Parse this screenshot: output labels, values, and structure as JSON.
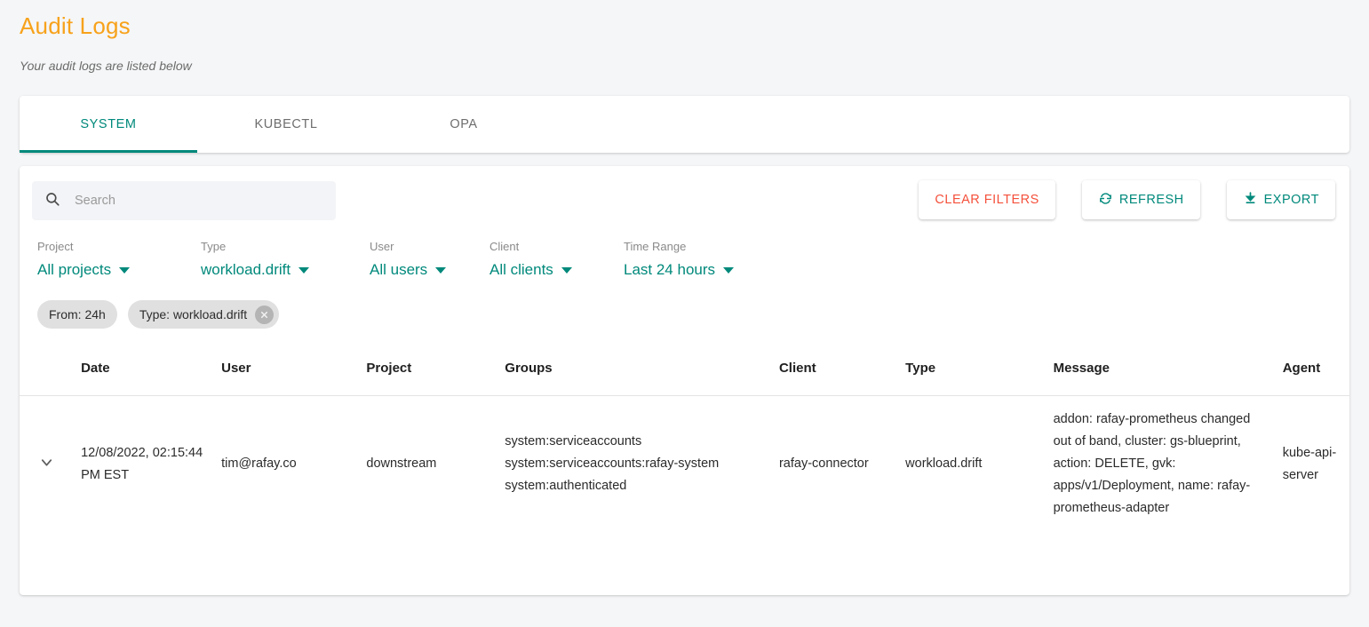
{
  "header": {
    "title": "Audit Logs",
    "subtitle": "Your audit logs are listed below"
  },
  "tabs": [
    {
      "label": "SYSTEM",
      "active": true
    },
    {
      "label": "KUBECTL",
      "active": false
    },
    {
      "label": "OPA",
      "active": false
    }
  ],
  "search": {
    "placeholder": "Search",
    "value": "",
    "icon": "search-icon"
  },
  "actions": {
    "clear_filters": "CLEAR FILTERS",
    "refresh": "REFRESH",
    "export": "EXPORT",
    "refresh_icon": "refresh-icon",
    "export_icon": "download-icon"
  },
  "filters": [
    {
      "label": "Project",
      "value": "All projects"
    },
    {
      "label": "Type",
      "value": "workload.drift"
    },
    {
      "label": "User",
      "value": "All users"
    },
    {
      "label": "Client",
      "value": "All clients"
    },
    {
      "label": "Time Range",
      "value": "Last 24 hours"
    }
  ],
  "chips": [
    {
      "label": "From: 24h",
      "deletable": false
    },
    {
      "label": "Type: workload.drift",
      "deletable": true
    }
  ],
  "table": {
    "columns": [
      "",
      "Date",
      "User",
      "Project",
      "Groups",
      "Client",
      "Type",
      "Message",
      "Agent"
    ],
    "rows": [
      {
        "date": "12/08/2022, 02:15:44 PM EST",
        "user": "tim@rafay.co",
        "project": "downstream",
        "groups": "system:serviceaccounts\nsystem:serviceaccounts:rafay-system\nsystem:authenticated",
        "client": "rafay-connector",
        "type": "workload.drift",
        "message": "addon: rafay-prometheus changed out of band, cluster: gs-blueprint, action: DELETE, gvk: apps/v1/Deployment, name: rafay-prometheus-adapter",
        "agent": "kube-api-server",
        "expand_icon": "chevron-down-icon"
      }
    ]
  },
  "colors": {
    "title": "#f7a21b",
    "accent": "#00897b",
    "danger": "#f4503b",
    "page_bg": "#f5f6f7",
    "chip_bg": "#e0e0e0"
  }
}
